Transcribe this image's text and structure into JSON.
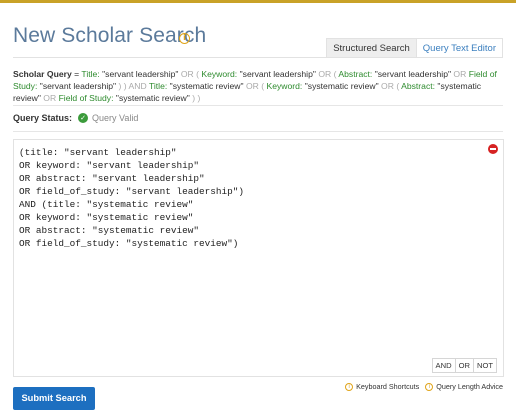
{
  "header": {
    "title": "New Scholar Search",
    "info_icon": "info-icon"
  },
  "tabs": [
    {
      "label": "Structured Search",
      "active": true
    },
    {
      "label": "Query Text Editor",
      "active": false
    }
  ],
  "summary": {
    "label": "Scholar Query",
    "equals": "=",
    "tokens": {
      "title_f": "Title:",
      "keyword_f": "Keyword:",
      "abstract_f": "Abstract:",
      "fos_f": "Field of Study:",
      "v1": "\"servant leadership\"",
      "v2": "\"systematic review\"",
      "or": "OR",
      "and": "AND",
      "lp": "(",
      "rp": ")"
    }
  },
  "status": {
    "label": "Query Status:",
    "value": "Query Valid"
  },
  "editor": {
    "lines": [
      "(title: \"servant leadership\"",
      "OR keyword: \"servant leadership\"",
      "OR abstract: \"servant leadership\"",
      "OR field_of_study: \"servant leadership\")",
      "AND (title: \"systematic review\"",
      "OR keyword: \"systematic review\"",
      "OR abstract: \"systematic review\"",
      "OR field_of_study: \"systematic review\")"
    ],
    "operators": [
      "AND",
      "OR",
      "NOT"
    ]
  },
  "hints": {
    "shortcuts": "Keyboard Shortcuts",
    "length": "Query Length Advice"
  },
  "submit_label": "Submit Search",
  "colors": {
    "accent_gold": "#c9a227",
    "title_blue": "#5b7a9b",
    "link_blue": "#3b7fbf",
    "button_blue": "#1d6fc0",
    "field_green": "#2e8b2e",
    "valid_green": "#3b9b3b",
    "clear_red": "#d62222"
  }
}
